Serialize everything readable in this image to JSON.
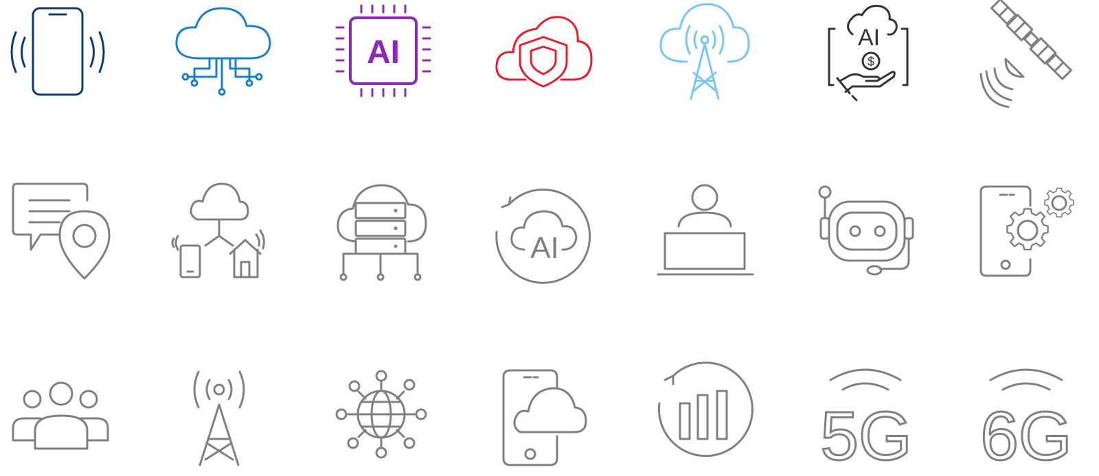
{
  "colors": {
    "navy": "#0b3a74",
    "blue": "#1a7fc9",
    "purple": "#8a2bb6",
    "red": "#e5202e",
    "sky": "#79c6f2",
    "dark": "#333333",
    "gray": "#808080"
  },
  "icons": [
    {
      "name": "vibrating-phone-icon",
      "color": "navy"
    },
    {
      "name": "cloud-network-icon",
      "color": "blue"
    },
    {
      "name": "ai-chip-icon",
      "color": "purple",
      "label": "AI"
    },
    {
      "name": "cloud-security-shield-icon",
      "color": "red"
    },
    {
      "name": "cloud-broadcast-tower-icon",
      "color": "sky"
    },
    {
      "name": "ai-cost-hand-icon",
      "color": "dark",
      "label": "AI",
      "symbol": "$"
    },
    {
      "name": "satellite-icon",
      "color": "gray"
    },
    {
      "name": "chat-location-icon",
      "color": "gray"
    },
    {
      "name": "cloud-devices-home-icon",
      "color": "gray"
    },
    {
      "name": "cloud-server-icon",
      "color": "gray"
    },
    {
      "name": "ai-cloud-refresh-icon",
      "color": "gray",
      "label": "AI"
    },
    {
      "name": "user-laptop-icon",
      "color": "gray"
    },
    {
      "name": "chatbot-headset-icon",
      "color": "gray"
    },
    {
      "name": "phone-settings-icon",
      "color": "gray"
    },
    {
      "name": "team-group-icon",
      "color": "gray"
    },
    {
      "name": "cell-tower-icon",
      "color": "gray"
    },
    {
      "name": "global-network-icon",
      "color": "gray"
    },
    {
      "name": "phone-cloud-icon",
      "color": "gray"
    },
    {
      "name": "signal-bars-refresh-icon",
      "color": "gray"
    },
    {
      "name": "5g-icon",
      "color": "gray",
      "label": "5G"
    },
    {
      "name": "6g-icon",
      "color": "gray",
      "label": "6G"
    }
  ]
}
